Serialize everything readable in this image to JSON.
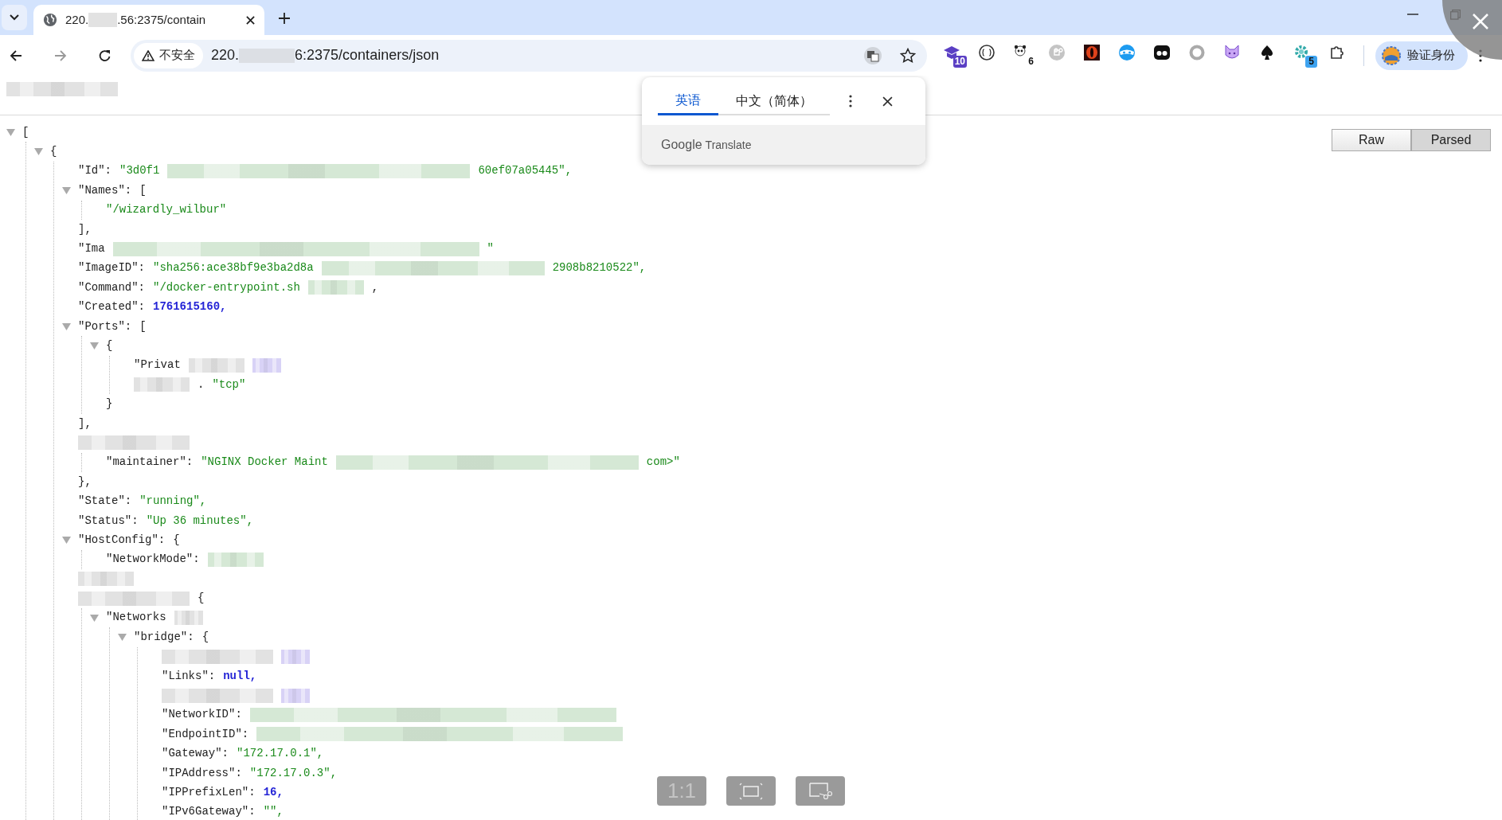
{
  "tab": {
    "title_start": "220.",
    "title_end": ".56:2375/contain"
  },
  "omnibox": {
    "security": "不安全",
    "url_start": "220.",
    "url_end": "6:2375/containers/json"
  },
  "extensions": [
    {
      "kind": "cap",
      "badge": "10"
    },
    {
      "kind": "braces"
    },
    {
      "kind": "panda",
      "badge": "6"
    },
    {
      "kind": "command"
    },
    {
      "kind": "eye"
    },
    {
      "kind": "mask"
    },
    {
      "kind": "dots"
    },
    {
      "kind": "ring"
    },
    {
      "kind": "cat"
    },
    {
      "kind": "spade"
    },
    {
      "kind": "gear",
      "badge": "5"
    },
    {
      "kind": "puzzle"
    }
  ],
  "profile": {
    "label": "验证身份"
  },
  "bookmarks_bar": {
    "kind": "redacted_medium",
    "color": "#e2e2e2"
  },
  "translate_popup": {
    "languages": [
      {
        "label": "英语",
        "selected": true
      },
      {
        "label": "中文（简体）",
        "selected": false
      }
    ],
    "brand": "Google",
    "product": "Translate"
  },
  "view_toggle": [
    {
      "label": "Raw",
      "selected": false
    },
    {
      "label": "Parsed",
      "selected": true
    }
  ],
  "zoom_controls": [
    {
      "kind": "text",
      "label": "1:1"
    },
    {
      "kind": "fit"
    },
    {
      "kind": "crop"
    }
  ],
  "json_tree": [
    {
      "kind": "node",
      "expanded": true,
      "parts": [
        {
          "kind": "punct",
          "text": "["
        }
      ],
      "children": [
        {
          "kind": "node",
          "expanded": true,
          "parts": [
            {
              "kind": "punct",
              "text": "{"
            }
          ],
          "children": [
            {
              "kind": "line",
              "parts": [
                {
                  "kind": "key",
                  "text": "\"Id\":"
                },
                {
                  "kind": "string",
                  "text": "\"3d0f1"
                },
                {
                  "kind": "redacted_xlong",
                  "color": "#d5e8d5"
                },
                {
                  "kind": "string",
                  "text": "60ef07a05445\","
                }
              ]
            },
            {
              "kind": "node",
              "expanded": true,
              "parts": [
                {
                  "kind": "key",
                  "text": "\"Names\":"
                },
                {
                  "kind": "punct",
                  "text": "["
                }
              ],
              "children": [
                {
                  "kind": "line",
                  "parts": [
                    {
                      "kind": "string",
                      "text": "\"/wizardly_wilbur\""
                    }
                  ]
                }
              ],
              "close": [
                {
                  "kind": "punct",
                  "text": "],"
                }
              ]
            },
            {
              "kind": "line",
              "parts": [
                {
                  "kind": "key",
                  "text": "\"Ima"
                },
                {
                  "kind": "redacted_xxlong",
                  "color": "#d5e8d5"
                },
                {
                  "kind": "string",
                  "text": "\""
                }
              ]
            },
            {
              "kind": "line",
              "parts": [
                {
                  "kind": "key",
                  "text": "\"ImageID\":"
                },
                {
                  "kind": "string",
                  "text": "\"sha256:ace38bf9e3ba2d8a"
                },
                {
                  "kind": "redacted_long",
                  "color": "#d5e8d5"
                },
                {
                  "kind": "string",
                  "text": "2908b8210522\","
                }
              ]
            },
            {
              "kind": "line",
              "parts": [
                {
                  "kind": "key",
                  "text": "\"Command\":"
                },
                {
                  "kind": "string",
                  "text": "\"/docker-entrypoint.sh"
                },
                {
                  "kind": "redacted_short",
                  "color": "#d5e8d5"
                },
                {
                  "kind": "punct",
                  "text": ","
                }
              ]
            },
            {
              "kind": "line",
              "parts": [
                {
                  "kind": "key",
                  "text": "\"Created\":"
                },
                {
                  "kind": "number",
                  "text": "1761615160,"
                }
              ]
            },
            {
              "kind": "node",
              "expanded": true,
              "parts": [
                {
                  "kind": "key",
                  "text": "\"Ports\":"
                },
                {
                  "kind": "punct",
                  "text": "["
                }
              ],
              "children": [
                {
                  "kind": "node",
                  "expanded": true,
                  "parts": [
                    {
                      "kind": "punct",
                      "text": "{"
                    }
                  ],
                  "children": [
                    {
                      "kind": "line",
                      "parts": [
                        {
                          "kind": "key",
                          "text": "\"Privat"
                        },
                        {
                          "kind": "redacted_short",
                          "color": "#e2e2e2"
                        },
                        {
                          "kind": "redacted_xs",
                          "color": "#d8d2f6"
                        }
                      ]
                    },
                    {
                      "kind": "line",
                      "parts": [
                        {
                          "kind": "redacted_short",
                          "color": "#e2e2e2"
                        },
                        {
                          "kind": "punct",
                          "text": "."
                        },
                        {
                          "kind": "string",
                          "text": "\"tcp\""
                        }
                      ]
                    }
                  ],
                  "close": [
                    {
                      "kind": "punct",
                      "text": "}"
                    }
                  ]
                }
              ],
              "close": [
                {
                  "kind": "punct",
                  "text": "],"
                }
              ]
            },
            {
              "kind": "node",
              "parts": [
                {
                  "kind": "redacted_medium",
                  "color": "#e2e2e2"
                }
              ],
              "children": [
                {
                  "kind": "line",
                  "parts": [
                    {
                      "kind": "key",
                      "text": "\"maintainer\":"
                    },
                    {
                      "kind": "string",
                      "text": "\"NGINX Docker Maint"
                    },
                    {
                      "kind": "redacted_xlong",
                      "color": "#d5e8d5"
                    },
                    {
                      "kind": "string",
                      "text": "com>\""
                    }
                  ]
                }
              ],
              "close": [
                {
                  "kind": "punct",
                  "text": "},"
                }
              ]
            },
            {
              "kind": "line",
              "parts": [
                {
                  "kind": "key",
                  "text": "\"State\":"
                },
                {
                  "kind": "string",
                  "text": "\"running\","
                }
              ]
            },
            {
              "kind": "line",
              "parts": [
                {
                  "kind": "key",
                  "text": "\"Status\":"
                },
                {
                  "kind": "string",
                  "text": "\"Up 36 minutes\","
                }
              ]
            },
            {
              "kind": "node",
              "expanded": true,
              "parts": [
                {
                  "kind": "key",
                  "text": "\"HostConfig\":"
                },
                {
                  "kind": "punct",
                  "text": "{"
                }
              ],
              "children": [
                {
                  "kind": "line",
                  "parts": [
                    {
                      "kind": "key",
                      "text": "\"NetworkMode\":"
                    },
                    {
                      "kind": "redacted_short",
                      "color": "#d5e8d5"
                    }
                  ]
                }
              ],
              "close": [
                {
                  "kind": "redacted_short",
                  "color": "#e2e2e2"
                }
              ]
            },
            {
              "kind": "node",
              "parts": [
                {
                  "kind": "redacted_medium",
                  "color": "#e2e2e2"
                },
                {
                  "kind": "punct",
                  "text": "{"
                }
              ],
              "children": [
                {
                  "kind": "node",
                  "expanded": true,
                  "parts": [
                    {
                      "kind": "key",
                      "text": "\"Networks"
                    },
                    {
                      "kind": "redacted_xs",
                      "color": "#e2e2e2"
                    }
                  ],
                  "children": [
                    {
                      "kind": "node",
                      "expanded": true,
                      "parts": [
                        {
                          "kind": "key",
                          "text": "\"bridge\":"
                        },
                        {
                          "kind": "punct",
                          "text": "{"
                        }
                      ],
                      "children": [
                        {
                          "kind": "line",
                          "parts": [
                            {
                              "kind": "redacted_medium",
                              "color": "#e2e2e2"
                            },
                            {
                              "kind": "redacted_xs",
                              "color": "#d8d2f6"
                            }
                          ]
                        },
                        {
                          "kind": "line",
                          "parts": [
                            {
                              "kind": "key",
                              "text": "\"Links\":"
                            },
                            {
                              "kind": "number",
                              "text": "null,"
                            }
                          ]
                        },
                        {
                          "kind": "line",
                          "parts": [
                            {
                              "kind": "redacted_medium",
                              "color": "#e2e2e2"
                            },
                            {
                              "kind": "redacted_xs",
                              "color": "#d8d2f6"
                            }
                          ]
                        },
                        {
                          "kind": "line",
                          "parts": [
                            {
                              "kind": "key",
                              "text": "\"NetworkID\":"
                            },
                            {
                              "kind": "redacted_xxlong",
                              "color": "#d5e8d5"
                            }
                          ]
                        },
                        {
                          "kind": "line",
                          "parts": [
                            {
                              "kind": "key",
                              "text": "\"EndpointID\":"
                            },
                            {
                              "kind": "redacted_xxlong",
                              "color": "#d5e8d5"
                            }
                          ]
                        },
                        {
                          "kind": "line",
                          "parts": [
                            {
                              "kind": "key",
                              "text": "\"Gateway\":"
                            },
                            {
                              "kind": "string",
                              "text": "\"172.17.0.1\","
                            }
                          ]
                        },
                        {
                          "kind": "line",
                          "parts": [
                            {
                              "kind": "key",
                              "text": "\"IPAddress\":"
                            },
                            {
                              "kind": "string",
                              "text": "\"172.17.0.3\","
                            }
                          ]
                        },
                        {
                          "kind": "line",
                          "parts": [
                            {
                              "kind": "key",
                              "text": "\"IPPrefixLen\":"
                            },
                            {
                              "kind": "number",
                              "text": "16,"
                            }
                          ]
                        },
                        {
                          "kind": "line",
                          "parts": [
                            {
                              "kind": "key",
                              "text": "\"IPv6Gateway\":"
                            },
                            {
                              "kind": "string",
                              "text": "\"\","
                            }
                          ]
                        }
                      ]
                    }
                  ]
                }
              ]
            }
          ]
        }
      ]
    }
  ]
}
